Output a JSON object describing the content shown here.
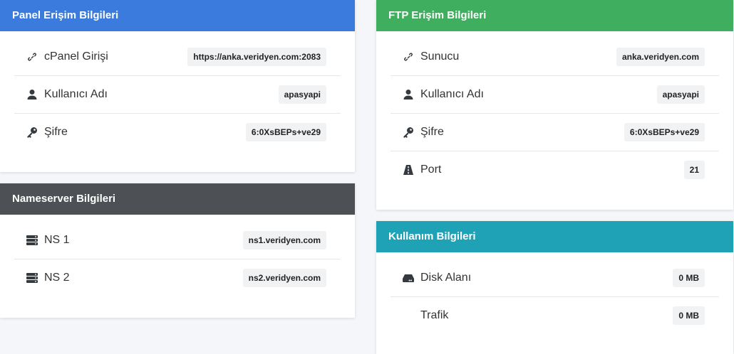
{
  "panel": {
    "title": "Panel Erişim Bilgileri",
    "rows": [
      {
        "label": "cPanel Girişi",
        "value": "https://anka.veridyen.com:2083",
        "icon": "link-icon"
      },
      {
        "label": "Kullanıcı Adı",
        "value": "apasyapi",
        "icon": "user-icon"
      },
      {
        "label": "Şifre",
        "value": "6:0XsBEPs+ve29",
        "icon": "key-icon"
      }
    ]
  },
  "nameserver": {
    "title": "Nameserver Bilgileri",
    "rows": [
      {
        "label": "NS 1",
        "value": "ns1.veridyen.com",
        "icon": "server-icon"
      },
      {
        "label": "NS 2",
        "value": "ns2.veridyen.com",
        "icon": "server-icon"
      }
    ]
  },
  "ftp": {
    "title": "FTP Erişim Bilgileri",
    "rows": [
      {
        "label": "Sunucu",
        "value": "anka.veridyen.com",
        "icon": "link-icon"
      },
      {
        "label": "Kullanıcı Adı",
        "value": "apasyapi",
        "icon": "user-icon"
      },
      {
        "label": "Şifre",
        "value": "6:0XsBEPs+ve29",
        "icon": "key-icon"
      },
      {
        "label": "Port",
        "value": "21",
        "icon": "road-icon"
      }
    ]
  },
  "usage": {
    "title": "Kullanım Bilgileri",
    "rows": [
      {
        "label": "Disk Alanı",
        "value": "0 MB",
        "icon": "hdd-icon"
      },
      {
        "label": "Trafik",
        "value": "0 MB",
        "icon": ""
      }
    ]
  },
  "colors": {
    "panel_header": "#3a7bdd",
    "nameserver_header": "#4d5155",
    "ftp_header": "#3fae5e",
    "usage_header": "#1fa2b6"
  }
}
